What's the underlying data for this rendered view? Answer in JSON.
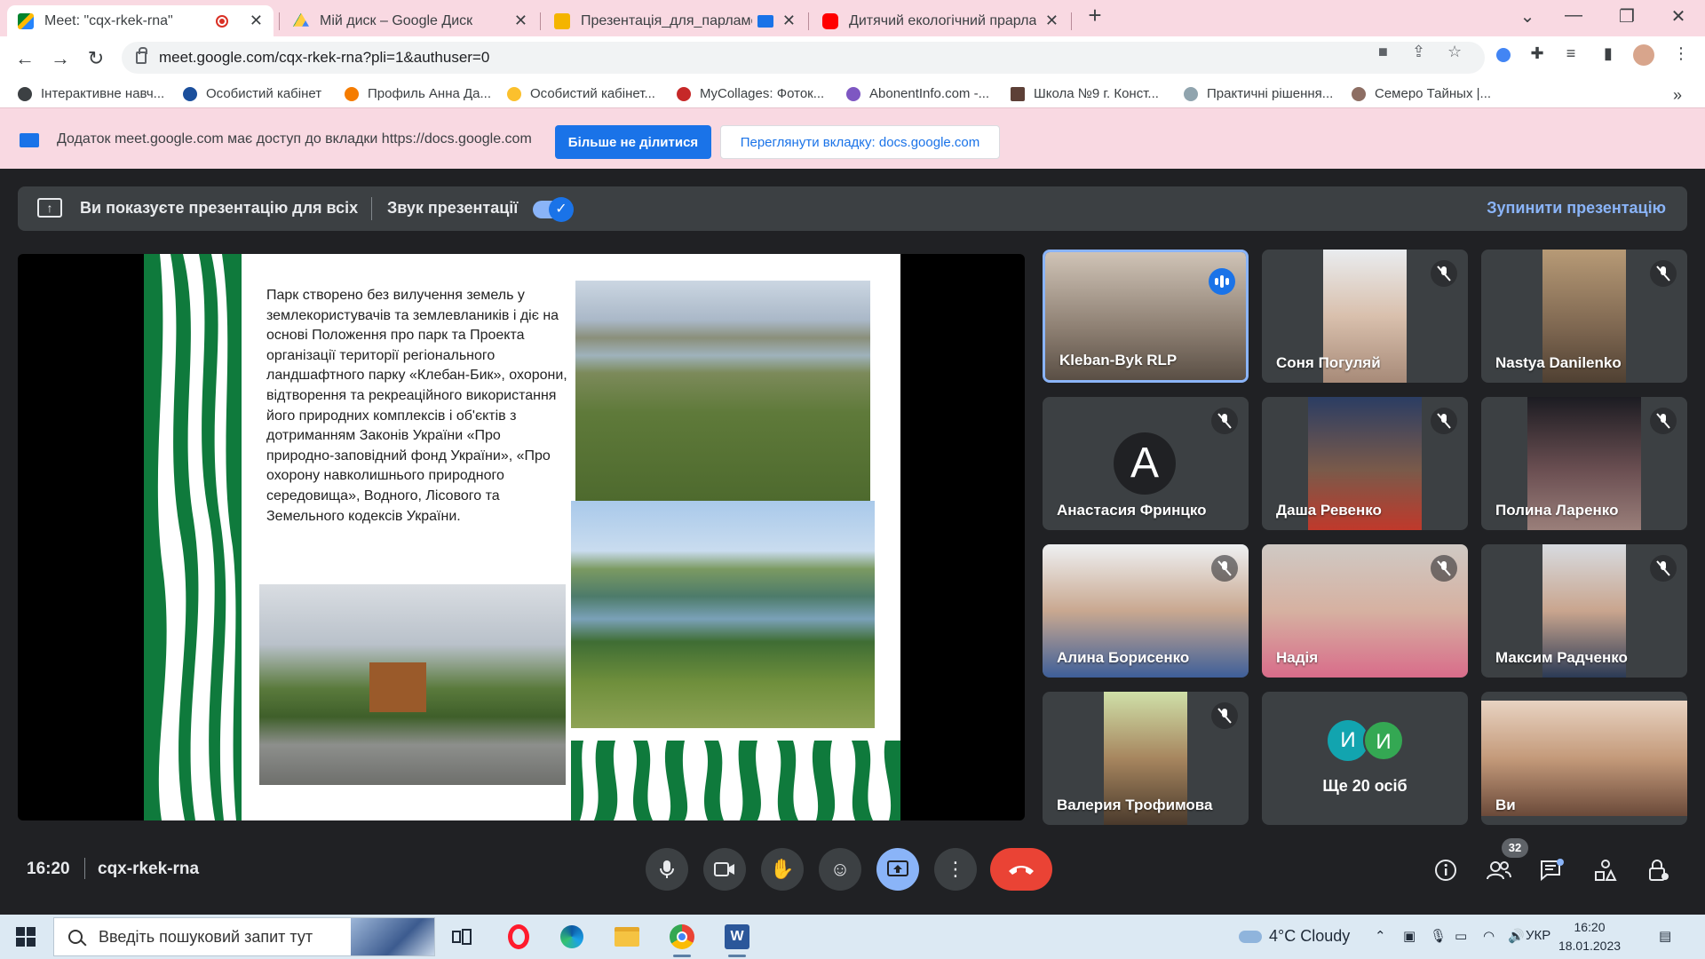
{
  "browser": {
    "tabs": [
      {
        "title": "Meet: \"cqx-rkek-rna\"",
        "active": true,
        "recording": true
      },
      {
        "title": "Мій диск – Google Диск"
      },
      {
        "title": "Презентація_для_парламен"
      },
      {
        "title": "Дитячий екологічний прарламе"
      }
    ],
    "new_tab": "+",
    "url": "meet.google.com/cqx-rkek-rna?pli=1&authuser=0",
    "bookmarks": [
      "Інтерактивне навч...",
      "Особистий кабінет",
      "Профиль Анна Да...",
      "Особистий кабінет...",
      "MyCollages: Фоток...",
      "AbonentInfo.com -...",
      "Школа №9 г. Конст...",
      "Практичні рішення...",
      "Семеро Тайных |..."
    ],
    "bookmarks_more": "»"
  },
  "infobar": {
    "message": "Додаток meet.google.com має доступ до вкладки https://docs.google.com",
    "stop_sharing": "Більше не ділитися",
    "view_tab": "Переглянути вкладку: docs.google.com"
  },
  "meet": {
    "banner_text": "Ви показуєте презентацію для всіх",
    "sound_label": "Звук презентації",
    "sound_on": true,
    "stop_presenting": "Зупинити презентацію",
    "slide_text": "Парк створено без вилучення земель у землекористувачів та землевлаників  і діє на основі Положення про парк та Проекта організації території регіонального ландшафтного парку «Клебан-Бик», охорони, відтворення та рекреаційного використання його природних комплексів і об'єктів з дотриманням Законів України «Про природно-заповідний фонд України», «Про охорону навколишнього природного середовища», Водного, Лісового та Земельного кодексів України.",
    "participants": [
      {
        "name": "Kleban-Byk RLP",
        "speaking": true
      },
      {
        "name": "Соня Погуляй",
        "muted": true
      },
      {
        "name": "Nastya Danilenko",
        "muted": true
      },
      {
        "name": "Анастасия Фринцко",
        "muted": true,
        "initial": "A"
      },
      {
        "name": "Даша Ревенко",
        "muted": true
      },
      {
        "name": "Полина Ларенко",
        "muted": true
      },
      {
        "name": "Алина Борисенко",
        "muted": true
      },
      {
        "name": "Надія",
        "muted": true
      },
      {
        "name": "Максим Радченко",
        "muted": true
      },
      {
        "name": "Валерия Трофимова",
        "muted": true
      },
      {
        "name": "Ще 20 осіб",
        "initials": [
          "И",
          "И"
        ]
      },
      {
        "name": "Ви"
      }
    ],
    "time": "16:20",
    "meeting_code": "cqx-rkek-rna",
    "people_count": "32"
  },
  "taskbar": {
    "search_placeholder": "Введіть пошуковий запит тут",
    "weather": "4°C  Cloudy",
    "language": "УКР",
    "time": "16:20",
    "date": "18.01.2023"
  }
}
